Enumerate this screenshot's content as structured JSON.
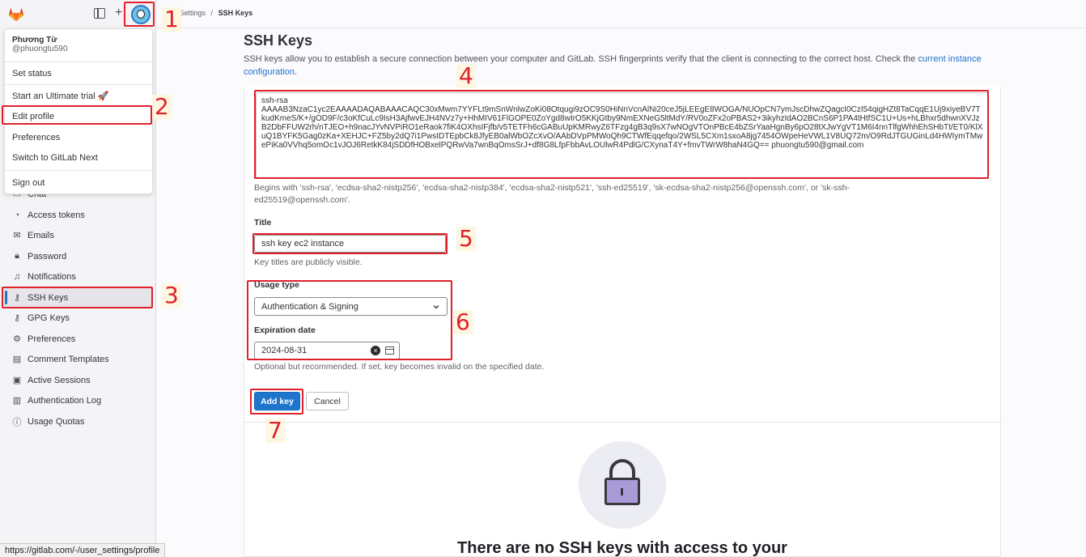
{
  "breadcrumb": {
    "parent": "User Settings",
    "separator": "/",
    "current": "SSH Keys"
  },
  "user_menu": {
    "name": "Phương Từ",
    "handle": "@phuongtu590",
    "items": [
      "Set status",
      "Start an Ultimate trial 🚀",
      "Edit profile",
      "Preferences",
      "Switch to GitLab Next",
      "Sign out"
    ]
  },
  "sidebar": {
    "items": [
      {
        "label": "Chat",
        "icon": "chat-icon"
      },
      {
        "label": "Access tokens",
        "icon": "token-icon"
      },
      {
        "label": "Emails",
        "icon": "mail-icon"
      },
      {
        "label": "Password",
        "icon": "lock-icon"
      },
      {
        "label": "Notifications",
        "icon": "bell-icon"
      },
      {
        "label": "SSH Keys",
        "icon": "key-icon"
      },
      {
        "label": "GPG Keys",
        "icon": "key-icon"
      },
      {
        "label": "Preferences",
        "icon": "preferences-icon"
      },
      {
        "label": "Comment Templates",
        "icon": "comment-icon"
      },
      {
        "label": "Active Sessions",
        "icon": "monitor-icon"
      },
      {
        "label": "Authentication Log",
        "icon": "log-icon"
      },
      {
        "label": "Usage Quotas",
        "icon": "info-icon"
      }
    ]
  },
  "main": {
    "title": "SSH Keys",
    "intro_text": "SSH keys allow you to establish a secure connection between your computer and GitLab. SSH fingerprints verify that the client is connecting to the correct host. Check the ",
    "intro_link": "current instance configuration",
    "intro_end": ".",
    "key_value": "ssh-rsa\nAAAAB3NzaC1yc2EAAAADAQABAAACAQC30xMwm7YYFLt9mSnWnlwZoKi08Otqugi9zOC9S0HiNnVcnAlNi20ceJ5jLEEgE8WOGA/NUOpCN7ymJscDhwZQagcI0CzI54qigHZt8TaCqqE1Uj9xiyeBV7TkudKmeS/K+/gOD9F/c3oKfCuLc9IsH3AjfwvEJH4NVz7y+HhMIV61FlGOPE0ZoYgd8wIrO5KKjGtby9NmEXNeG5ltMdY/RV0oZFx2oPBAS2+3ikyhzIdAO2BCnS6P1PA4tHtfSC1U+Us+hLBhxr5dhwnXVJzB2DbFFUW2rh/nTJEO+h9nacJYvNVPiRO1eRaok7fiK4OXhsIFjfb/v5TETFh6cGABuUpKMRwyZ6TFzg4gB3q9sX7wNOgVTOnPBcE4bZSrYaaHgnBy6pO28tXJwYgVT1M6I4nnTlfgWhhEhSHbTt/ET0/KlXuQ1BYFK5Gag0zKa+XEHJC+FZ5by2dQ7i1PwsIDTEpbCk8JfyEB0alWbOZcXvO/AAbDVpPMWoQh9CTWfEqqefqo/2WSL5CXm1sxoA8jg7454OWpeHeVWL1V8UQ72m/O9RdJTGUGinLd4HWIymTMwePiKa0VVhq5omOc1vJOJ6RetkK84jSDDfHOBxelPQRwVa7wnBqOmsSrJ+df8G8LfpFbbAvLOUlwR4PdlG/CXynaT4Y+fmvTWrW8haN4GQ== phuongtu590@gmail.com",
    "key_help": "Begins with 'ssh-rsa', 'ecdsa-sha2-nistp256', 'ecdsa-sha2-nistp384', 'ecdsa-sha2-nistp521', 'ssh-ed25519', 'sk-ecdsa-sha2-nistp256@openssh.com', or 'sk-ssh-ed25519@openssh.com'.",
    "title_label": "Title",
    "title_value": "ssh key ec2 instance",
    "title_help": "Key titles are publicly visible.",
    "usage_label": "Usage type",
    "usage_value": "Authentication & Signing",
    "expiration_label": "Expiration date",
    "expiration_value": "2024-08-31",
    "expiration_help": "Optional but recommended. If set, key becomes invalid on the specified date.",
    "add_button": "Add key",
    "cancel_button": "Cancel",
    "empty_title": "There are no SSH keys with access to your"
  },
  "annotations": [
    "1",
    "2",
    "3",
    "4",
    "5",
    "6",
    "7"
  ],
  "status_url": "https://gitlab.com/-/user_settings/profile",
  "colors": {
    "accent": "#1f75cb",
    "annotation": "#e0212c"
  }
}
